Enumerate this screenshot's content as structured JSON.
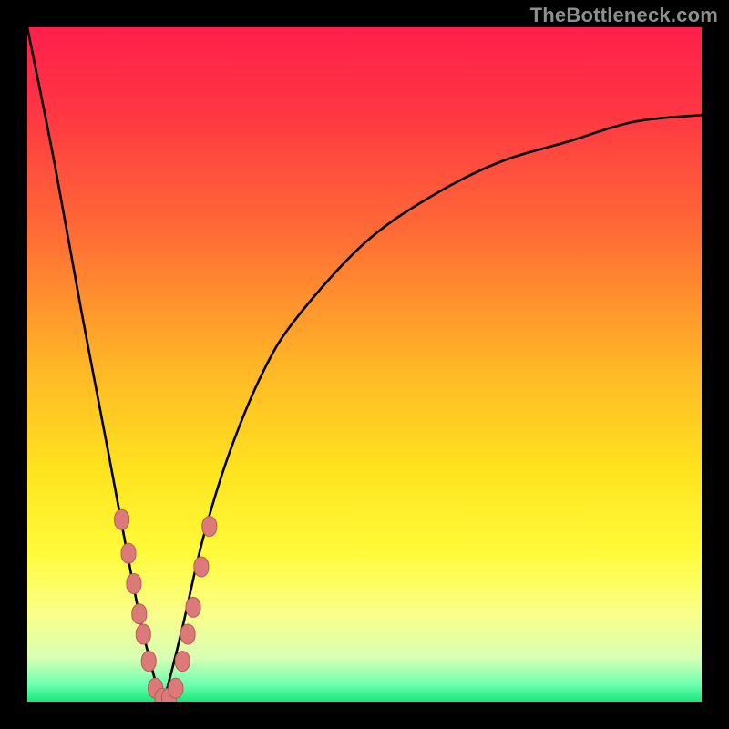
{
  "watermark": {
    "text": "TheBottleneck.com"
  },
  "colors": {
    "black": "#000000",
    "curve": "#000000",
    "marker_fill": "#db7a78",
    "marker_stroke": "#b55a58",
    "gradient_stops": [
      {
        "offset": 0.0,
        "color": "#ff1f4b"
      },
      {
        "offset": 0.12,
        "color": "#ff3544"
      },
      {
        "offset": 0.3,
        "color": "#ff6a36"
      },
      {
        "offset": 0.5,
        "color": "#ffb527"
      },
      {
        "offset": 0.66,
        "color": "#ffe41f"
      },
      {
        "offset": 0.78,
        "color": "#fffb3a"
      },
      {
        "offset": 0.87,
        "color": "#fbff8a"
      },
      {
        "offset": 0.935,
        "color": "#d8ffb4"
      },
      {
        "offset": 0.975,
        "color": "#6cffb0"
      },
      {
        "offset": 1.0,
        "color": "#17e87a"
      }
    ]
  },
  "chart_data": {
    "type": "line",
    "title": "",
    "xlabel": "",
    "ylabel": "",
    "x_range": [
      0,
      100
    ],
    "y_range": [
      0,
      100
    ],
    "grid": false,
    "note": "Bottleneck-style chart: y is a mismatch percentage that dips to 0 at the optimal x (~20) and rises steeply either side. Values below are read off the plotted curve (height as % of plot; x as % across).",
    "series": [
      {
        "name": "bottleneck-curve",
        "x": [
          0,
          4,
          8,
          12,
          15,
          17,
          19,
          20,
          21,
          23,
          26,
          30,
          35,
          40,
          50,
          60,
          70,
          80,
          90,
          100
        ],
        "values": [
          100,
          80,
          58,
          37,
          21,
          11,
          3,
          0,
          3,
          11,
          24,
          37,
          49,
          57,
          68,
          75,
          80,
          83,
          86,
          87
        ]
      }
    ],
    "markers": {
      "name": "sample-points",
      "note": "Salmon rounded markers clustered near the curve minimum on both branches.",
      "points": [
        {
          "x": 14.0,
          "y": 27.0
        },
        {
          "x": 15.0,
          "y": 22.0
        },
        {
          "x": 15.8,
          "y": 17.5
        },
        {
          "x": 16.6,
          "y": 13.0
        },
        {
          "x": 17.2,
          "y": 10.0
        },
        {
          "x": 18.0,
          "y": 6.0
        },
        {
          "x": 19.0,
          "y": 2.0
        },
        {
          "x": 20.0,
          "y": 0.5
        },
        {
          "x": 21.0,
          "y": 0.5
        },
        {
          "x": 22.0,
          "y": 2.0
        },
        {
          "x": 23.0,
          "y": 6.0
        },
        {
          "x": 23.8,
          "y": 10.0
        },
        {
          "x": 24.6,
          "y": 14.0
        },
        {
          "x": 25.8,
          "y": 20.0
        },
        {
          "x": 27.0,
          "y": 26.0
        }
      ]
    }
  }
}
